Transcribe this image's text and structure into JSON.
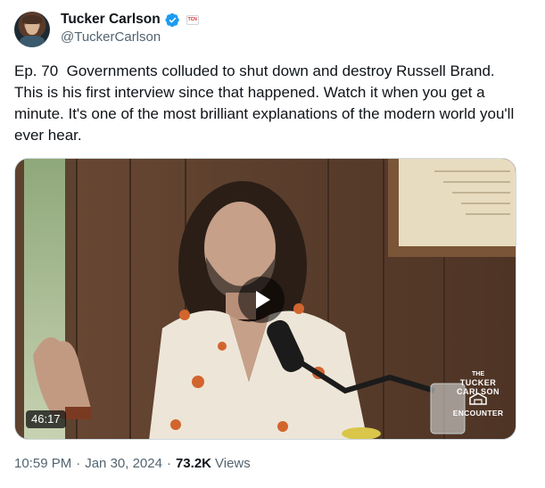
{
  "author": {
    "display_name": "Tucker Carlson",
    "handle": "@TuckerCarlson",
    "verified_color": "#1d9bf0",
    "affiliation_badge": "TCN"
  },
  "tweet": {
    "text": "Ep. 70  Governments colluded to shut down and destroy Russell Brand. This is his first interview since that happened. Watch it when you get a minute. It's one of the most brilliant explanations of the modern world you'll ever hear."
  },
  "media": {
    "duration": "46:17",
    "logo": {
      "top": "THE",
      "arc": "TUCKER CARLSON",
      "bottom": "ENCOUNTER"
    }
  },
  "meta": {
    "time": "10:59 PM",
    "separator": "·",
    "date": "Jan 30, 2024",
    "views_count": "73.2K",
    "views_label": "Views"
  }
}
